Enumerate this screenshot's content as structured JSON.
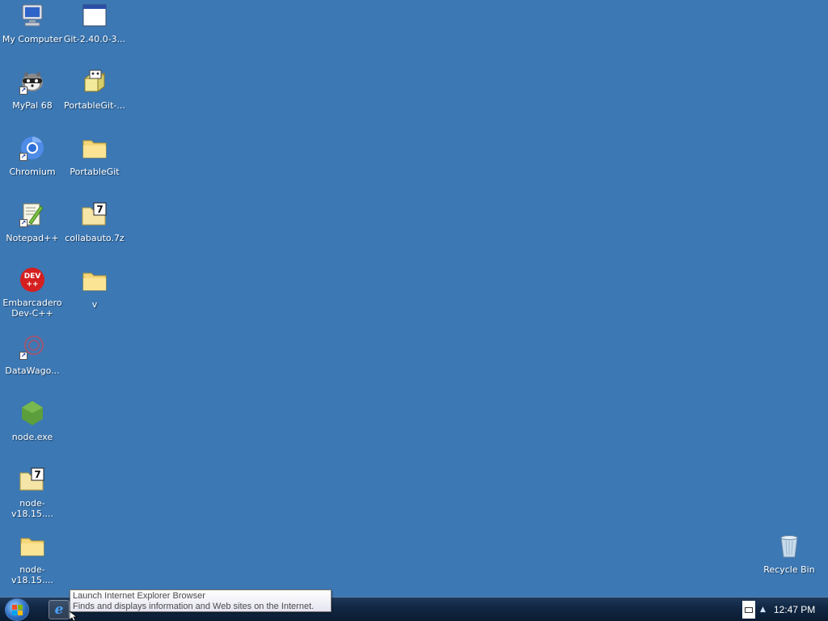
{
  "desktop": {
    "icons": [
      {
        "label": "My Computer",
        "icon": "computer-icon"
      },
      {
        "label": "Git-2.40.0-3...",
        "icon": "installer-window-icon"
      },
      {
        "label": "MyPal 68",
        "icon": "raccoon-icon"
      },
      {
        "label": "PortableGit-...",
        "icon": "setup-package-icon"
      },
      {
        "label": "Chromium",
        "icon": "chromium-icon"
      },
      {
        "label": "PortableGit",
        "icon": "folder-icon"
      },
      {
        "label": "Notepad++",
        "icon": "notepadpp-icon"
      },
      {
        "label": "collabauto.7z",
        "icon": "7z-archive-icon"
      },
      {
        "label": "Embarcadero Dev-C++",
        "icon": "devcpp-icon"
      },
      {
        "label": "v",
        "icon": "folder-icon"
      },
      {
        "label": "DataWago...",
        "icon": "datawagon-icon"
      },
      {
        "label": "node.exe",
        "icon": "node-icon"
      },
      {
        "label": "node-v18.15....",
        "icon": "7z-archive-icon"
      },
      {
        "label": "node-v18.15....",
        "icon": "folder-icon"
      },
      {
        "label": "Recycle Bin",
        "icon": "recycle-bin-icon"
      }
    ]
  },
  "taskbar": {
    "clock": "12:47 PM"
  },
  "tooltip": {
    "title": "Launch Internet Explorer Browser",
    "text": "Finds and displays information and Web sites on the Internet."
  },
  "colors": {
    "desktop": "#3c78b4",
    "taskbar": "#122844",
    "folder": "#f5d77a"
  }
}
